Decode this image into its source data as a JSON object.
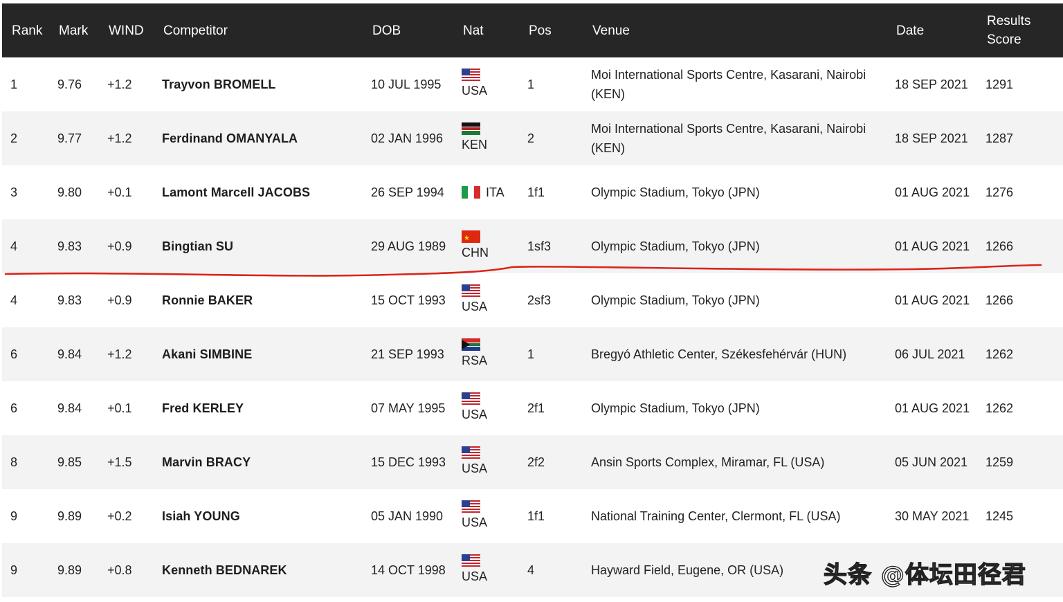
{
  "table": {
    "headers": [
      "Rank",
      "Mark",
      "WIND",
      "Competitor",
      "DOB",
      "Nat",
      "Pos",
      "Venue",
      "Date",
      "Results Score"
    ],
    "rows": [
      {
        "rank": "1",
        "mark": "9.76",
        "wind": "+1.2",
        "competitor": "Trayvon BROMELL",
        "dob": "10 JUL 1995",
        "nat": "USA",
        "pos": "1",
        "venue": "Moi International Sports Centre, Kasarani, Nairobi (KEN)",
        "date": "18 SEP 2021",
        "score": "1291"
      },
      {
        "rank": "2",
        "mark": "9.77",
        "wind": "+1.2",
        "competitor": "Ferdinand OMANYALA",
        "dob": "02 JAN 1996",
        "nat": "KEN",
        "pos": "2",
        "venue": "Moi International Sports Centre, Kasarani, Nairobi (KEN)",
        "date": "18 SEP 2021",
        "score": "1287"
      },
      {
        "rank": "3",
        "mark": "9.80",
        "wind": "+0.1",
        "competitor": "Lamont Marcell JACOBS",
        "dob": "26 SEP 1994",
        "nat": "ITA",
        "pos": "1f1",
        "venue": "Olympic Stadium, Tokyo (JPN)",
        "date": "01 AUG 2021",
        "score": "1276"
      },
      {
        "rank": "4",
        "mark": "9.83",
        "wind": "+0.9",
        "competitor": "Bingtian SU",
        "dob": "29 AUG 1989",
        "nat": "CHN",
        "pos": "1sf3",
        "venue": "Olympic Stadium, Tokyo (JPN)",
        "date": "01 AUG 2021",
        "score": "1266"
      },
      {
        "rank": "4",
        "mark": "9.83",
        "wind": "+0.9",
        "competitor": "Ronnie BAKER",
        "dob": "15 OCT 1993",
        "nat": "USA",
        "pos": "2sf3",
        "venue": "Olympic Stadium, Tokyo (JPN)",
        "date": "01 AUG 2021",
        "score": "1266"
      },
      {
        "rank": "6",
        "mark": "9.84",
        "wind": "+1.2",
        "competitor": "Akani SIMBINE",
        "dob": "21 SEP 1993",
        "nat": "RSA",
        "pos": "1",
        "venue": "Bregyó Athletic Center, Székesfehérvár (HUN)",
        "date": "06 JUL 2021",
        "score": "1262"
      },
      {
        "rank": "6",
        "mark": "9.84",
        "wind": "+0.1",
        "competitor": "Fred KERLEY",
        "dob": "07 MAY 1995",
        "nat": "USA",
        "pos": "2f1",
        "venue": "Olympic Stadium, Tokyo (JPN)",
        "date": "01 AUG 2021",
        "score": "1262"
      },
      {
        "rank": "8",
        "mark": "9.85",
        "wind": "+1.5",
        "competitor": "Marvin BRACY",
        "dob": "15 DEC 1993",
        "nat": "USA",
        "pos": "2f2",
        "venue": "Ansin Sports Complex, Miramar, FL (USA)",
        "date": "05 JUN 2021",
        "score": "1259"
      },
      {
        "rank": "9",
        "mark": "9.89",
        "wind": "+0.2",
        "competitor": "Isiah YOUNG",
        "dob": "05 JAN 1990",
        "nat": "USA",
        "pos": "1f1",
        "venue": "National Training Center, Clermont, FL (USA)",
        "date": "30 MAY 2021",
        "score": "1245"
      },
      {
        "rank": "9",
        "mark": "9.89",
        "wind": "+0.8",
        "competitor": "Kenneth BEDNAREK",
        "dob": "14 OCT 1998",
        "nat": "USA",
        "pos": "4",
        "venue": "Hayward Field, Eugene, OR (USA)",
        "date": "",
        "score": ""
      }
    ]
  },
  "colors": {
    "header_bg": "#262626",
    "row_alt": "#f3f3f3",
    "marker_line": "#d9251c"
  },
  "watermark": "头条 @体坛田径君"
}
